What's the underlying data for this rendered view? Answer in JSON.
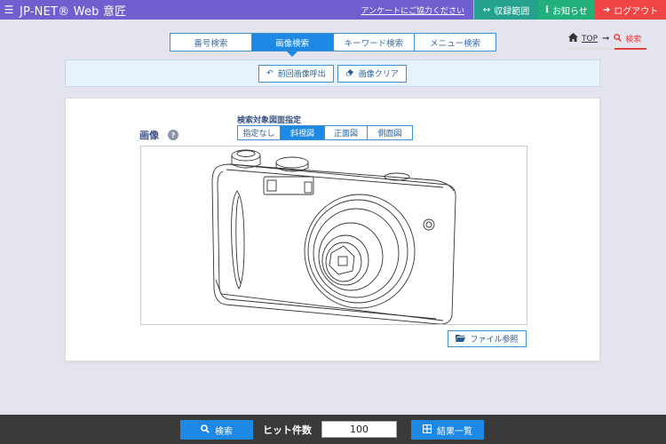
{
  "header": {
    "menu_icon": "☰",
    "app_title": "JP-NET® Web 意匠",
    "survey_link": "アンケートにご協力ください",
    "range_label": "収録範囲",
    "notice_label": "お知らせ",
    "logout_label": "ログアウト",
    "colors": {
      "bar": "#6f5fcf",
      "range": "#25a18e",
      "notice": "#22b07a",
      "logout": "#ef4545"
    }
  },
  "tabs": [
    {
      "label": "番号検索",
      "active": false
    },
    {
      "label": "画像検索",
      "active": true
    },
    {
      "label": "キーワード検索",
      "active": false
    },
    {
      "label": "メニュー検索",
      "active": false
    }
  ],
  "breadcrumb": {
    "top": "TOP",
    "current": "検索"
  },
  "toolbar": {
    "recall_label": "前回画像呼出",
    "clear_label": "画像クリア"
  },
  "search_form": {
    "image_label": "画像",
    "view_caption": "検索対象図面指定",
    "views": [
      {
        "label": "指定なし",
        "active": false
      },
      {
        "label": "斜視図",
        "active": true
      },
      {
        "label": "正面図",
        "active": false
      },
      {
        "label": "側面図",
        "active": false
      }
    ],
    "file_button": "ファイル参照"
  },
  "footer": {
    "search_label": "検索",
    "hit_label": "ヒット件数",
    "hit_count": "100",
    "list_label": "結果一覧"
  },
  "accent_color": "#1e88e5"
}
